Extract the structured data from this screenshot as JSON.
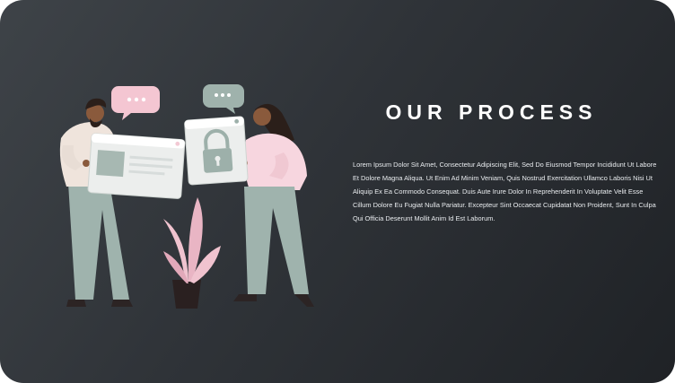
{
  "slide": {
    "title": "OUR PROCESS",
    "body": "Lorem Ipsum Dolor Sit Amet, Consectetur Adipiscing Elit, Sed Do Eiusmod Tempor Incididunt Ut Labore Et Dolore Magna Aliqua. Ut Enim Ad Minim Veniam, Quis Nostrud Exercitation Ullamco Laboris Nisi Ut Aliquip Ex Ea Commodo Consequat. Duis Aute Irure Dolor In Reprehenderit In Voluptate Velit Esse Cillum Dolore Eu Fugiat Nulla Pariatur. Excepteur Sint Occaecat Cupidatat Non Proident, Sunt In Culpa Qui Officia Deserunt Mollit Anim Id Est Laborum."
  },
  "colors": {
    "background_start": "#3e4348",
    "background_end": "#1f2226",
    "pink": "#f3c9d4",
    "sage": "#9db0aa",
    "title": "#ffffff"
  },
  "icons": [
    "chat-bubble-icon",
    "lock-icon",
    "browser-window-icon",
    "plant-icon"
  ]
}
